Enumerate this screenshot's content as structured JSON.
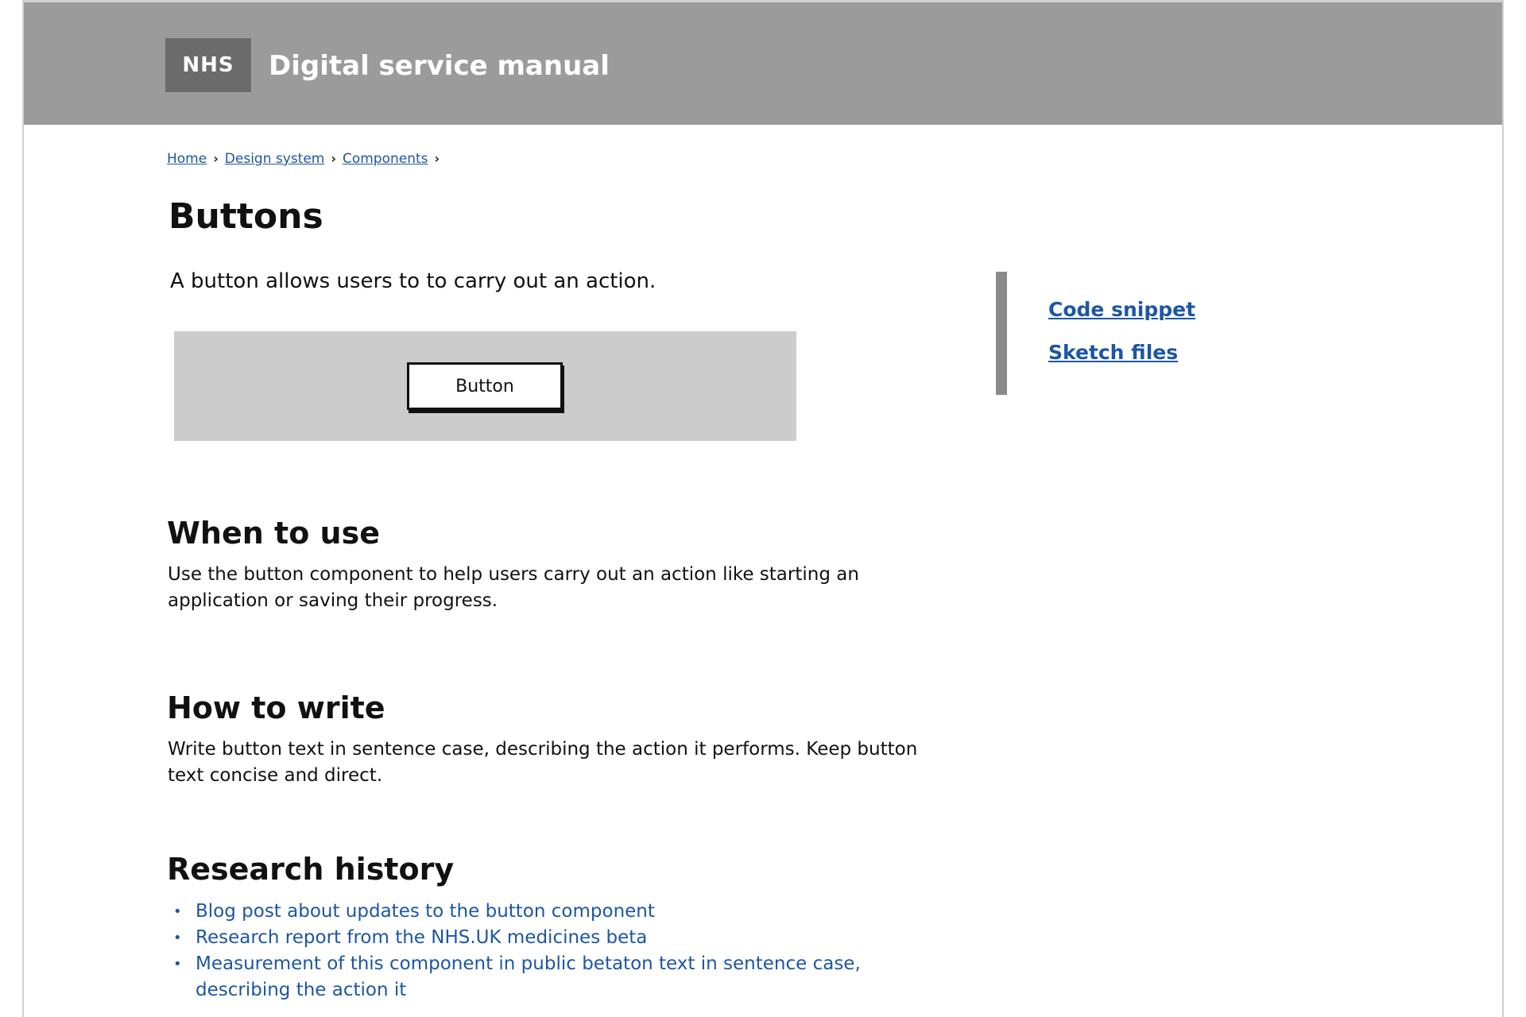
{
  "header": {
    "logo_text": "NHS",
    "site_title": "Digital service manual"
  },
  "breadcrumb": {
    "items": [
      "Home",
      "Design system",
      "Components"
    ],
    "separator": "›"
  },
  "main": {
    "title": "Buttons",
    "lede": "A button allows users to to carry out an action.",
    "example_button_label": "Button",
    "sections": {
      "when_to_use": {
        "heading": "When to use",
        "body": "Use the button component to help users carry out an action like starting an application or saving their progress."
      },
      "how_to_write": {
        "heading": "How to write",
        "body": "Write button text in sentence case, describing the action it performs. Keep button text concise and direct."
      },
      "research_history": {
        "heading": "Research history",
        "links": [
          "Blog post about updates to the button component",
          "Research report from the NHS.UK medicines beta",
          "Measurement of this component in public betaton text in sentence case, describing the action it"
        ]
      }
    }
  },
  "aside": {
    "links": [
      "Code snippet",
      "Sketch files"
    ]
  },
  "colors": {
    "header_bg": "#9b9b9b",
    "logo_bg": "#6b6b6b",
    "link": "#1d56a3",
    "example_bg": "#cccccc"
  }
}
